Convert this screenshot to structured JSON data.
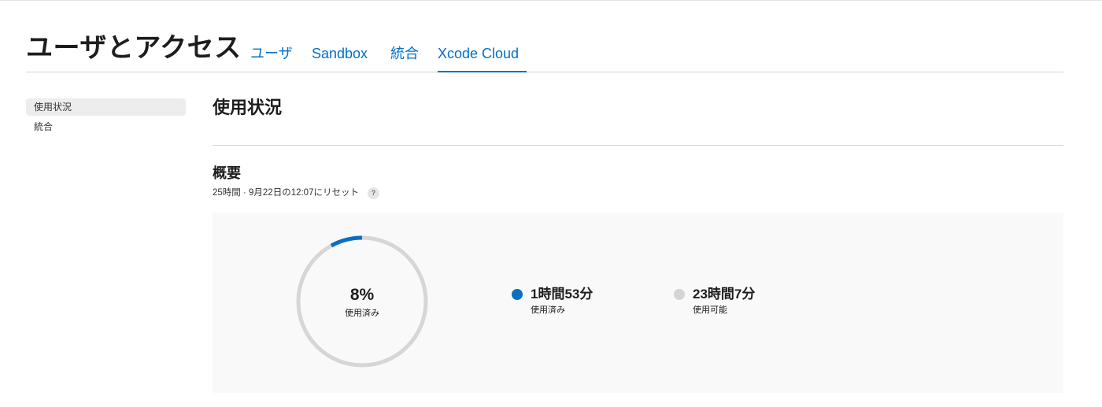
{
  "page": {
    "title": "ユーザとアクセス"
  },
  "tabs": [
    {
      "label": "ユーザ",
      "active": false
    },
    {
      "label": "Sandbox",
      "active": false
    },
    {
      "label": "統合",
      "active": false
    },
    {
      "label": "Xcode Cloud",
      "active": true
    }
  ],
  "sidebar": {
    "items": [
      {
        "label": "使用状況",
        "selected": true
      },
      {
        "label": "統合",
        "selected": false
      }
    ]
  },
  "main": {
    "heading": "使用状況",
    "section_title": "概要",
    "section_subtitle": "25時間 · 9月22日の12:07にリセット",
    "help_icon": {
      "name": "question-mark-icon",
      "glyph": "?"
    }
  },
  "usage": {
    "used_fraction": 0.08,
    "center_value": "8%",
    "center_label": "使用済み",
    "legend": [
      {
        "value": "1時間53分",
        "label": "使用済み",
        "color": "#0a6fc2"
      },
      {
        "value": "23時間7分",
        "label": "使用可能",
        "color": "#d4d4d4"
      }
    ]
  },
  "colors": {
    "accent": "#0070c9",
    "ring_used": "#0a6fc2",
    "ring_track": "#d6d6d6"
  }
}
